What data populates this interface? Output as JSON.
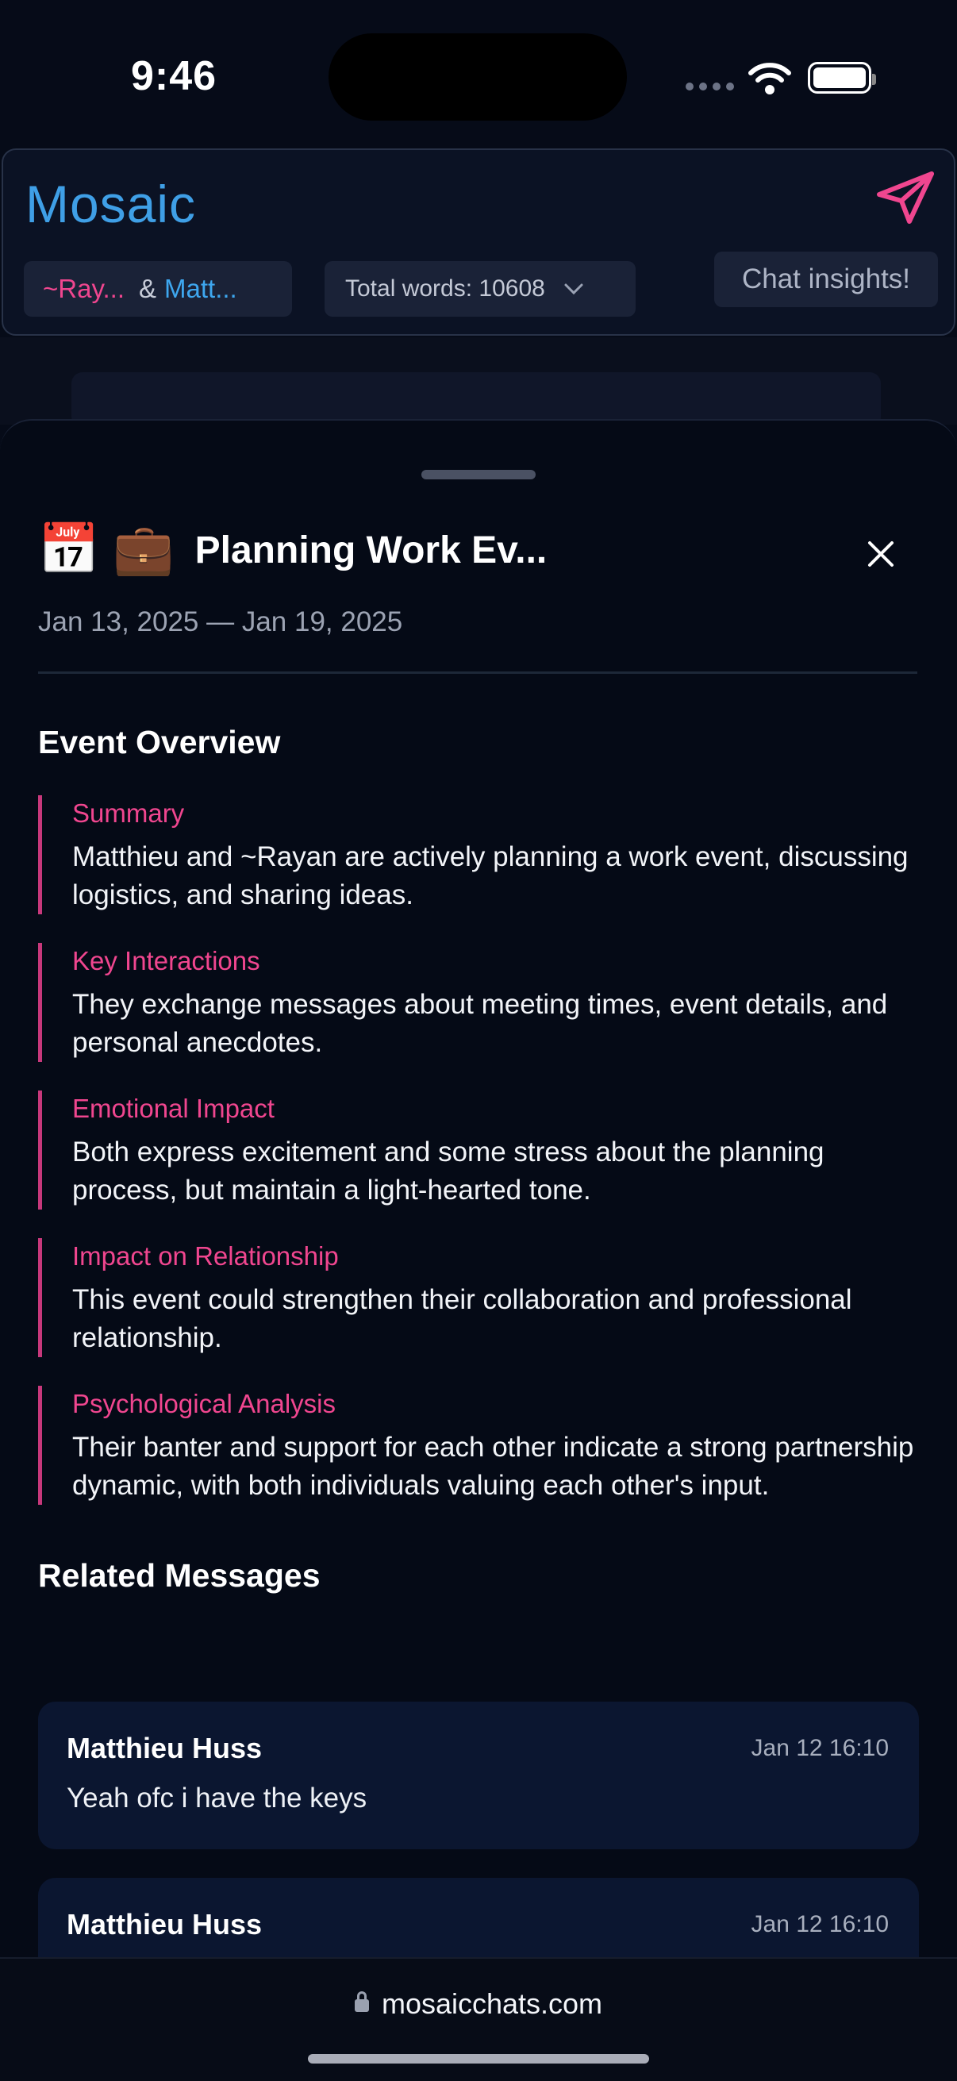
{
  "status": {
    "time": "9:46"
  },
  "header": {
    "brand": "Mosaic",
    "participant_1": "~Ray...",
    "amp": "&",
    "participant_2": "Matt...",
    "total_words_label": "Total words: 10608",
    "insights_label": "Chat insights!"
  },
  "event": {
    "emojis": "📅 💼",
    "title": "Planning Work Ev...",
    "date_range": "Jan 13, 2025 — Jan 19, 2025"
  },
  "overview": {
    "heading": "Event Overview",
    "items": [
      {
        "label": "Summary",
        "text": "Matthieu and ~Rayan are actively planning a work event, discussing logistics, and sharing ideas."
      },
      {
        "label": "Key Interactions",
        "text": "They exchange messages about meeting times, event details, and personal anecdotes."
      },
      {
        "label": "Emotional Impact",
        "text": "Both express excitement and some stress about the planning process, but maintain a light-hearted tone."
      },
      {
        "label": "Impact on Relationship",
        "text": "This event could strengthen their collaboration and professional relationship."
      },
      {
        "label": "Psychological Analysis",
        "text": "Their banter and support for each other indicate a strong partnership dynamic, with both individuals valuing each other's input."
      }
    ]
  },
  "related": {
    "heading": "Related Messages",
    "messages": [
      {
        "author": "Matthieu Huss",
        "time": "Jan 12 16:10",
        "text": "Yeah ofc i have the keys"
      },
      {
        "author": "Matthieu Huss",
        "time": "Jan 12 16:10",
        "text": ""
      }
    ]
  },
  "browser": {
    "url": "mosaicchats.com"
  },
  "colors": {
    "accent_pink": "#f0468f",
    "accent_blue": "#3ea7ef",
    "background": "#050a16"
  }
}
